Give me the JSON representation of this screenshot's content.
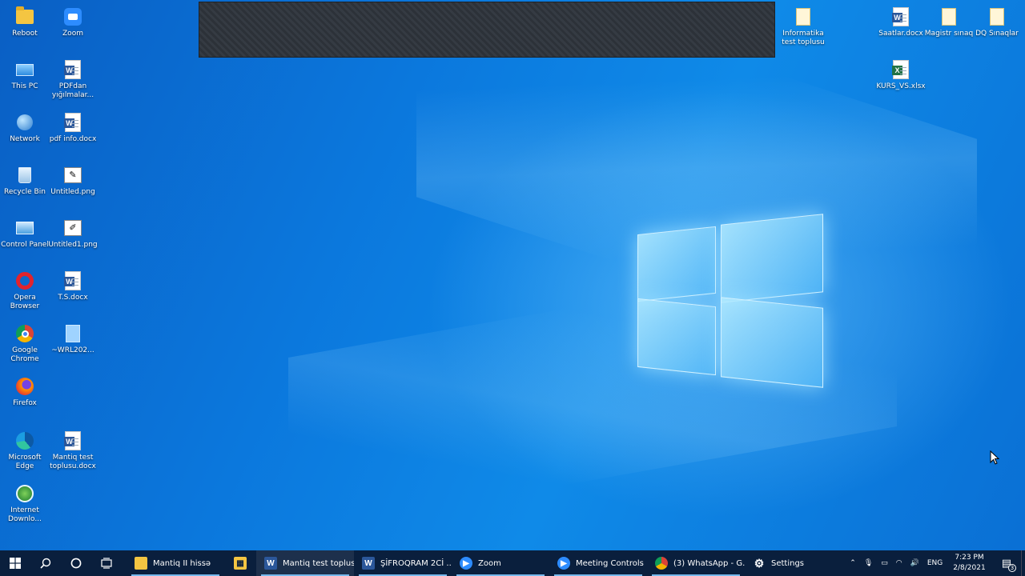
{
  "desktop": {
    "icons_left": [
      {
        "label": "Reboot",
        "icon": "folder-icon"
      },
      {
        "label": "Zoom",
        "icon": "zoom-icon"
      },
      {
        "label": "This PC",
        "icon": "computer-icon"
      },
      {
        "label": "PDFdan yığılmalar...",
        "icon": "word-doc-icon"
      },
      {
        "label": "Network",
        "icon": "network-icon"
      },
      {
        "label": "pdf info.docx",
        "icon": "word-doc-icon"
      },
      {
        "label": "Recycle Bin",
        "icon": "recycle-bin-icon"
      },
      {
        "label": "Untitled.png",
        "icon": "image-icon"
      },
      {
        "label": "Control Panel",
        "icon": "control-panel-icon"
      },
      {
        "label": "Untitled1.png",
        "icon": "image-icon"
      },
      {
        "label": "Opera Browser",
        "icon": "opera-icon"
      },
      {
        "label": "T.S.docx",
        "icon": "word-doc-icon"
      },
      {
        "label": "Google Chrome",
        "icon": "chrome-icon"
      },
      {
        "label": "~WRL202...",
        "icon": "blank-file-icon"
      },
      {
        "label": "Firefox",
        "icon": "firefox-icon"
      },
      {
        "label": "Microsoft Edge",
        "icon": "edge-icon"
      },
      {
        "label": "Mantiq test toplusu.docx",
        "icon": "word-doc-icon"
      },
      {
        "label": "Internet Downlo...",
        "icon": "idm-icon"
      }
    ],
    "icons_right": [
      {
        "label": "Informatika test toplusu",
        "icon": "folder-zip-icon"
      },
      {
        "label": "Saatlar.docx",
        "icon": "word-doc-icon"
      },
      {
        "label": "Magistr sınaq",
        "icon": "folder-zip-icon"
      },
      {
        "label": "DQ Sınaqlar",
        "icon": "folder-zip-icon"
      },
      {
        "label": "KURS_VS.xlsx",
        "icon": "excel-icon"
      }
    ]
  },
  "taskbar": {
    "apps": [
      {
        "label": "Mantiq II hissə",
        "icon": "folder-icon",
        "color": "#f4c542",
        "active": false
      },
      {
        "label": "",
        "icon": "store-icon",
        "color": "#f4c542",
        "active": false
      },
      {
        "label": "Mantiq test toplus...",
        "icon": "word-icon",
        "color": "#2b579a",
        "active": true
      },
      {
        "label": "ŞİFROQRAM 2Cİ ...",
        "icon": "word-icon",
        "color": "#2b579a",
        "active": false
      },
      {
        "label": "Zoom",
        "icon": "zoom-icon",
        "color": "#2d8cff",
        "active": false
      },
      {
        "label": "Meeting Controls",
        "icon": "zoom-icon",
        "color": "#2d8cff",
        "active": false
      },
      {
        "label": "(3) WhatsApp - G...",
        "icon": "chrome-icon",
        "color": "#db4437",
        "active": false
      },
      {
        "label": "Settings",
        "icon": "gear-icon",
        "color": "#ffffff",
        "active": false
      }
    ],
    "tray": {
      "language": "ENG",
      "time": "7:23 PM",
      "date": "2/8/2021",
      "notifications": "3"
    }
  },
  "colors": {
    "accent": "#76b9ed",
    "taskbar": "#0a1f3d",
    "word": "#2b579a",
    "excel": "#217346"
  }
}
